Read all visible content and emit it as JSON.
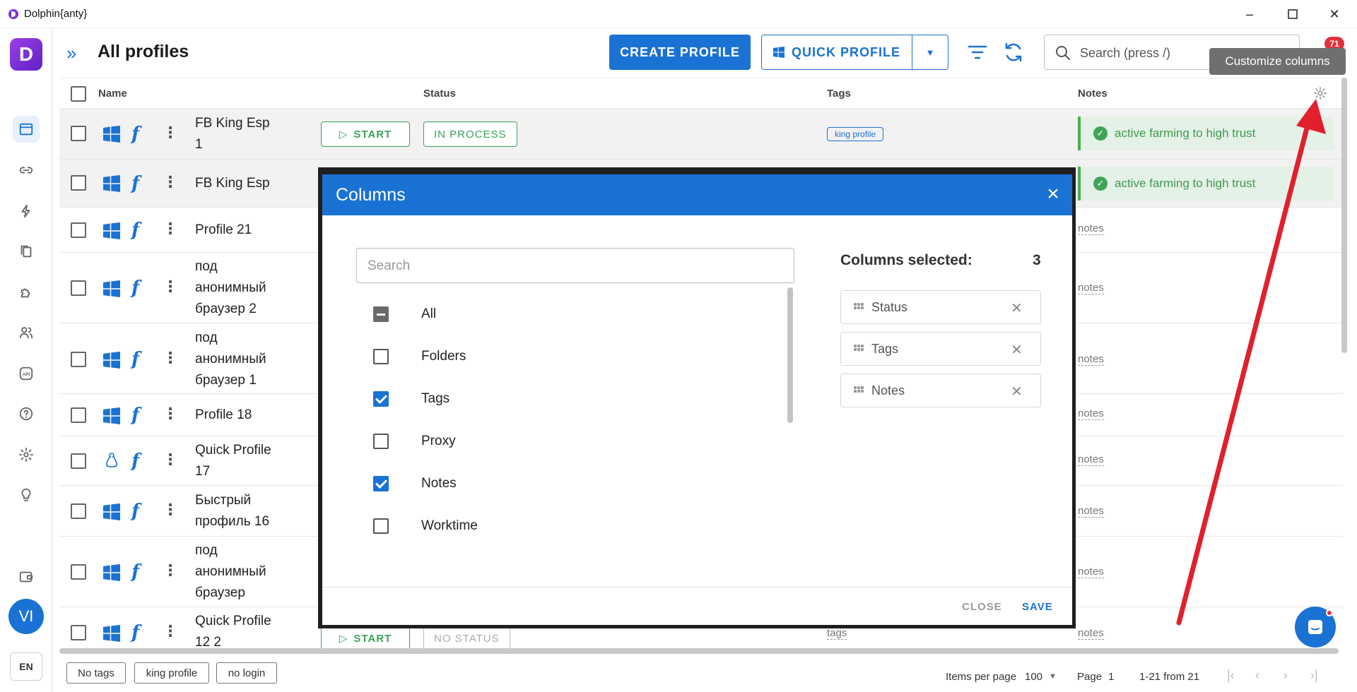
{
  "window": {
    "title": "Dolphin{anty}",
    "minimize": "–",
    "maximize": "☐",
    "close": "✕"
  },
  "sidebar": {
    "logo": "D",
    "avatar": "VI",
    "lang": "EN"
  },
  "header": {
    "title": "All profiles",
    "expand": "»",
    "create_profile": "CREATE PROFILE",
    "quick_profile": "QUICK PROFILE",
    "search_placeholder": "Search (press /)",
    "notifications": "71",
    "tooltip": "Customize columns"
  },
  "table": {
    "columns": {
      "name": "Name",
      "status": "Status",
      "tags": "Tags",
      "notes": "Notes"
    },
    "start_label": "START",
    "rows": [
      {
        "name": "FB King Esp 1",
        "os": "windows",
        "status": "IN PROCESS",
        "tag": "king profile",
        "note": "active farming to high trust"
      },
      {
        "name": "FB King Esp",
        "os": "windows",
        "note": "active farming to high trust"
      },
      {
        "name": "Profile 21",
        "os": "windows",
        "notes_link": "notes"
      },
      {
        "name": "под анонимный браузер 2",
        "os": "windows",
        "notes_link": "notes"
      },
      {
        "name": "под анонимный браузер 1",
        "os": "windows",
        "notes_link": "notes"
      },
      {
        "name": "Profile 18",
        "os": "windows",
        "notes_link": "notes"
      },
      {
        "name": "Quick Profile 17",
        "os": "linux",
        "notes_link": "notes"
      },
      {
        "name": "Быстрый профиль 16",
        "os": "windows",
        "notes_link": "notes"
      },
      {
        "name": "под анонимный браузер",
        "os": "windows",
        "notes_link": "notes"
      },
      {
        "name": "Quick Profile 12 2",
        "os": "windows",
        "status": "NO STATUS",
        "tags_link": "tags",
        "notes_link": "notes"
      }
    ]
  },
  "footer": {
    "chips": [
      "No tags",
      "king profile",
      "no login"
    ],
    "items_per_page_label": "Items per page",
    "items_per_page": "100",
    "page_label": "Page",
    "page": "1",
    "range": "1-21 from 21"
  },
  "modal": {
    "title": "Columns",
    "search_placeholder": "Search",
    "options": [
      {
        "label": "All",
        "state": "indeterminate"
      },
      {
        "label": "Folders",
        "state": "unchecked"
      },
      {
        "label": "Tags",
        "state": "checked"
      },
      {
        "label": "Proxy",
        "state": "unchecked"
      },
      {
        "label": "Notes",
        "state": "checked"
      },
      {
        "label": "Worktime",
        "state": "unchecked"
      }
    ],
    "selected_label": "Columns selected:",
    "selected_count": "3",
    "selected": [
      "Status",
      "Tags",
      "Notes"
    ],
    "close": "CLOSE",
    "save": "SAVE"
  },
  "colors": {
    "accent": "#1a72d4",
    "success": "#36a35a",
    "annotation": "#e0202c",
    "brand": "#7b2fd6"
  }
}
